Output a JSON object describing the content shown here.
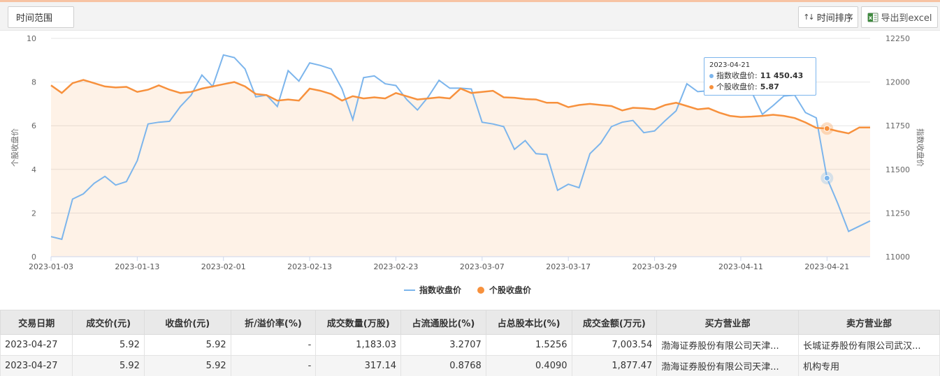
{
  "toolbar": {
    "range_label": "时间范围",
    "sort_label": "时间排序",
    "export_label": "导出到excel"
  },
  "chart_data": {
    "type": "line",
    "x": [
      "2023-01-03",
      "2023-01-04",
      "2023-01-05",
      "2023-01-06",
      "2023-01-09",
      "2023-01-10",
      "2023-01-11",
      "2023-01-12",
      "2023-01-13",
      "2023-01-16",
      "2023-01-17",
      "2023-01-18",
      "2023-01-19",
      "2023-01-20",
      "2023-01-30",
      "2023-01-31",
      "2023-02-01",
      "2023-02-02",
      "2023-02-03",
      "2023-02-06",
      "2023-02-07",
      "2023-02-08",
      "2023-02-09",
      "2023-02-10",
      "2023-02-13",
      "2023-02-14",
      "2023-02-15",
      "2023-02-16",
      "2023-02-17",
      "2023-02-20",
      "2023-02-21",
      "2023-02-22",
      "2023-02-23",
      "2023-02-24",
      "2023-02-27",
      "2023-02-28",
      "2023-03-01",
      "2023-03-02",
      "2023-03-03",
      "2023-03-06",
      "2023-03-07",
      "2023-03-08",
      "2023-03-09",
      "2023-03-10",
      "2023-03-13",
      "2023-03-14",
      "2023-03-15",
      "2023-03-16",
      "2023-03-17",
      "2023-03-20",
      "2023-03-21",
      "2023-03-22",
      "2023-03-23",
      "2023-03-24",
      "2023-03-27",
      "2023-03-28",
      "2023-03-29",
      "2023-03-30",
      "2023-03-31",
      "2023-04-03",
      "2023-04-04",
      "2023-04-06",
      "2023-04-07",
      "2023-04-10",
      "2023-04-11",
      "2023-04-12",
      "2023-04-13",
      "2023-04-14",
      "2023-04-17",
      "2023-04-18",
      "2023-04-19",
      "2023-04-20",
      "2023-04-21",
      "2023-04-24",
      "2023-04-25",
      "2023-04-26",
      "2023-04-27"
    ],
    "x_ticks": [
      "2023-01-03",
      "2023-01-13",
      "2023-02-01",
      "2023-02-13",
      "2023-02-23",
      "2023-03-07",
      "2023-03-17",
      "2023-03-29",
      "2023-04-11",
      "2023-04-21"
    ],
    "series": [
      {
        "name": "指数收盘价",
        "axis": "right",
        "color": "#7cb5ec",
        "values": [
          11115,
          11100,
          11330,
          11360,
          11420,
          11460,
          11410,
          11430,
          11550,
          11760,
          11770,
          11775,
          11860,
          11925,
          12040,
          11975,
          12155,
          12140,
          12075,
          11915,
          11925,
          11860,
          12065,
          12005,
          12110,
          12095,
          12075,
          11960,
          11785,
          12025,
          12035,
          11990,
          11980,
          11900,
          11840,
          11915,
          12010,
          11965,
          11965,
          11960,
          11770,
          11760,
          11745,
          11615,
          11665,
          11590,
          11585,
          11380,
          11415,
          11395,
          11590,
          11650,
          11745,
          11770,
          11780,
          11710,
          11720,
          11780,
          11835,
          11990,
          11945,
          11950,
          12055,
          11935,
          11940,
          11945,
          11815,
          11865,
          11920,
          11925,
          11825,
          11795,
          11450,
          11305,
          11145,
          11175,
          11205
        ]
      },
      {
        "name": "个股收盘价",
        "axis": "left",
        "color": "#f7913d",
        "values": [
          7.85,
          7.5,
          7.95,
          8.1,
          7.95,
          7.8,
          7.75,
          7.78,
          7.55,
          7.65,
          7.85,
          7.65,
          7.5,
          7.55,
          7.7,
          7.8,
          7.9,
          8.0,
          7.8,
          7.45,
          7.4,
          7.15,
          7.2,
          7.15,
          7.7,
          7.6,
          7.45,
          7.15,
          7.35,
          7.25,
          7.3,
          7.25,
          7.5,
          7.35,
          7.2,
          7.25,
          7.3,
          7.25,
          7.7,
          7.5,
          7.55,
          7.6,
          7.3,
          7.28,
          7.22,
          7.2,
          7.05,
          7.05,
          6.85,
          6.95,
          7.0,
          6.95,
          6.9,
          6.7,
          6.82,
          6.8,
          6.75,
          6.95,
          7.05,
          6.9,
          6.75,
          6.8,
          6.6,
          6.45,
          6.4,
          6.42,
          6.45,
          6.5,
          6.45,
          6.35,
          6.15,
          5.9,
          5.87,
          5.75,
          5.65,
          5.92,
          5.92
        ]
      }
    ],
    "ylabel_left": "个股收盘价",
    "ylabel_right": "指数收盘价",
    "ylim_left": [
      0,
      10
    ],
    "ylim_right": [
      11000,
      12250
    ],
    "yticks_left": [
      0,
      2,
      4,
      6,
      8,
      10
    ],
    "yticks_right": [
      11000,
      11250,
      11500,
      11750,
      12000,
      12250
    ],
    "grid": true,
    "legend_position": "bottom-center"
  },
  "tooltip": {
    "date": "2023-04-21",
    "index_label": "指数收盘价:",
    "index_value": "11 450.43",
    "stock_label": "个股收盘价:",
    "stock_value": "5.87"
  },
  "table": {
    "headers": [
      "交易日期",
      "成交价(元)",
      "收盘价(元)",
      "折/溢价率(%)",
      "成交数量(万股)",
      "占流通股比(%)",
      "占总股本比(%)",
      "成交金额(万元)",
      "买方营业部",
      "卖方营业部"
    ],
    "rows": [
      [
        "2023-04-27",
        "5.92",
        "5.92",
        "-",
        "1,183.03",
        "3.2707",
        "1.5256",
        "7,003.54",
        "渤海证券股份有限公司天津...",
        "长城证券股份有限公司武汉..."
      ],
      [
        "2023-04-27",
        "5.92",
        "5.92",
        "-",
        "317.14",
        "0.8768",
        "0.4090",
        "1,877.47",
        "渤海证券股份有限公司天津...",
        "机构专用"
      ]
    ]
  }
}
